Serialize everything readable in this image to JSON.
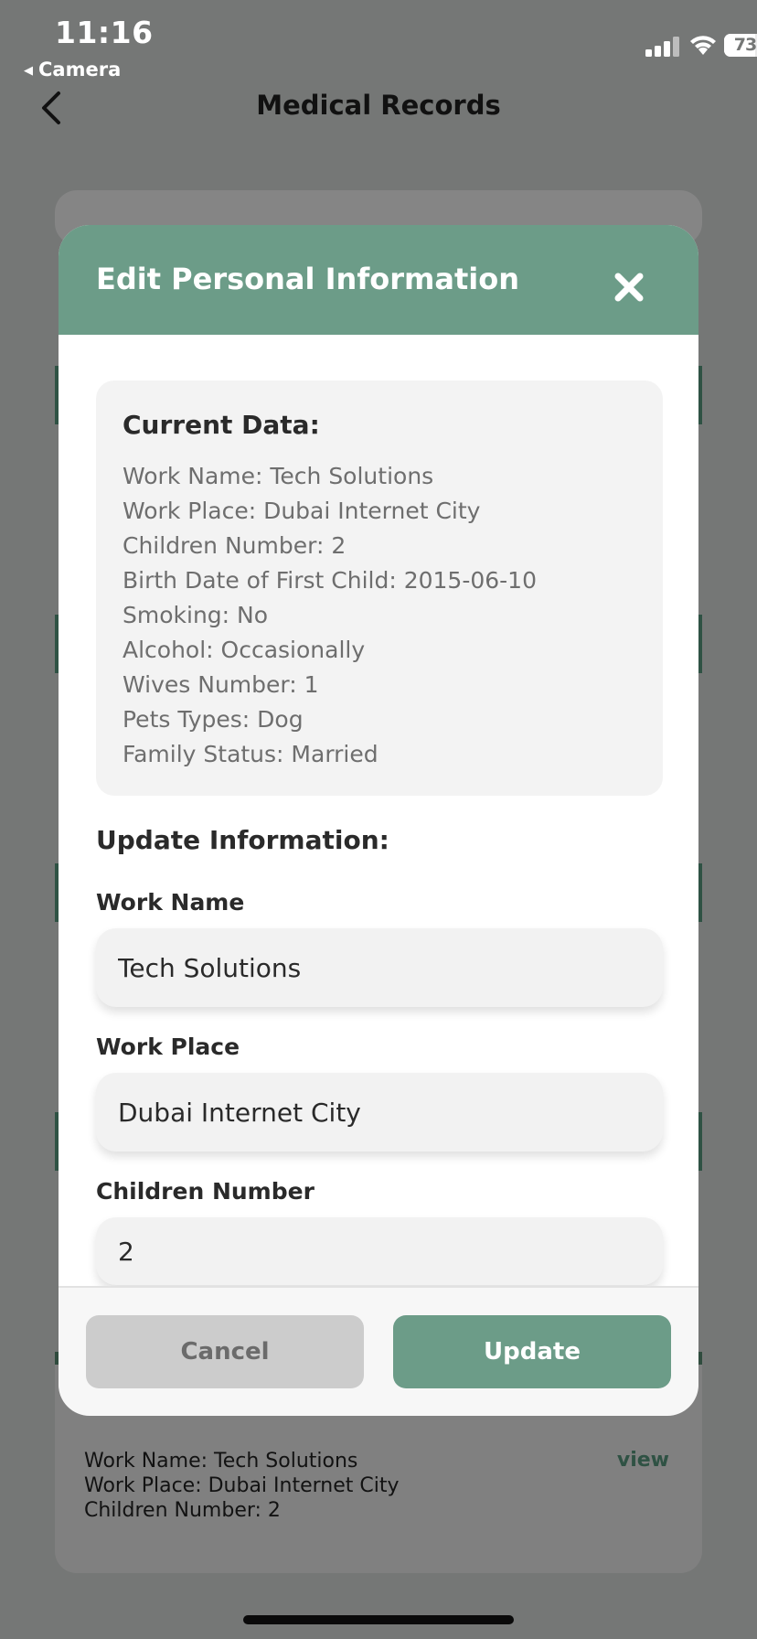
{
  "status_bar": {
    "time": "11:16",
    "back_app": "Camera",
    "battery_percent": "73",
    "battery_level": 0.73
  },
  "header": {
    "title": "Medical Records"
  },
  "background": {
    "summary_lines": [
      "Work Name: Tech Solutions",
      "Work Place: Dubai Internet City",
      "Children Number: 2"
    ],
    "view_link": "view"
  },
  "modal": {
    "title": "Edit Personal Information",
    "current_data_title": "Current Data:",
    "current_data": [
      "Work Name: Tech Solutions",
      "Work Place: Dubai Internet City",
      "Children Number: 2",
      "Birth Date of First Child: 2015-06-10",
      "Smoking: No",
      "Alcohol: Occasionally",
      "Wives Number: 1",
      "Pets Types: Dog",
      "Family Status: Married"
    ],
    "update_title": "Update Information:",
    "fields": [
      {
        "label": "Work Name",
        "value": "Tech Solutions"
      },
      {
        "label": "Work Place",
        "value": "Dubai Internet City"
      },
      {
        "label": "Children Number",
        "value": "2"
      }
    ],
    "cancel_label": "Cancel",
    "update_label": "Update"
  },
  "colors": {
    "accent": "#6c9c88",
    "overlay": "#757776",
    "dark_green": "#2f5244"
  }
}
